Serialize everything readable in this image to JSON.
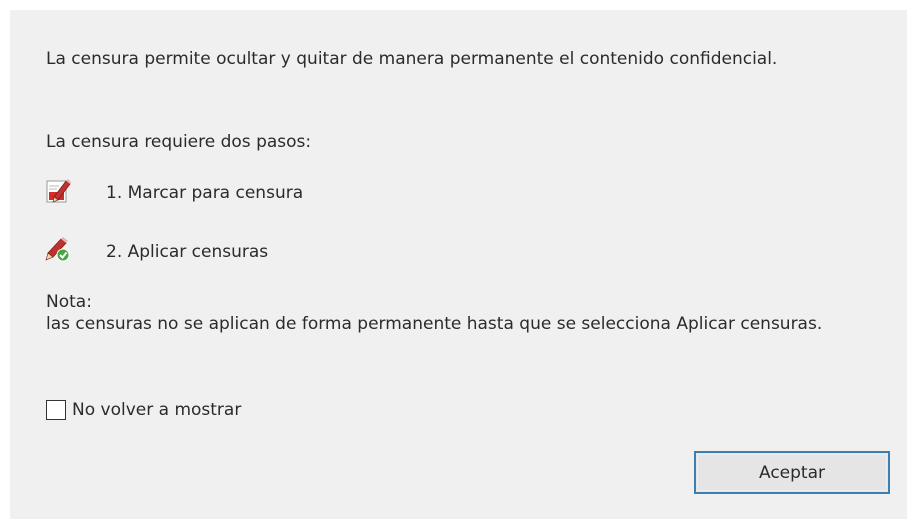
{
  "dialog": {
    "intro": "La censura permite ocultar y quitar de manera permanente el contenido confidencial.",
    "steps_heading": "La censura requiere dos pasos:",
    "steps": [
      {
        "label": "1. Marcar para censura",
        "icon": "mark-for-redaction-icon"
      },
      {
        "label": "2. Aplicar censuras",
        "icon": "apply-redactions-icon"
      }
    ],
    "note_title": "Nota:",
    "note_body": "las censuras no se aplican de forma permanente hasta que se selecciona Aplicar censuras.",
    "dont_show_again": {
      "label": "No volver a mostrar",
      "checked": false
    },
    "accept_label": "Aceptar"
  },
  "colors": {
    "dialog_background": "#f0f0f0",
    "button_border_focus": "#3c7fb1",
    "button_background": "#e5e5e5",
    "text": "#2b2b2b"
  }
}
